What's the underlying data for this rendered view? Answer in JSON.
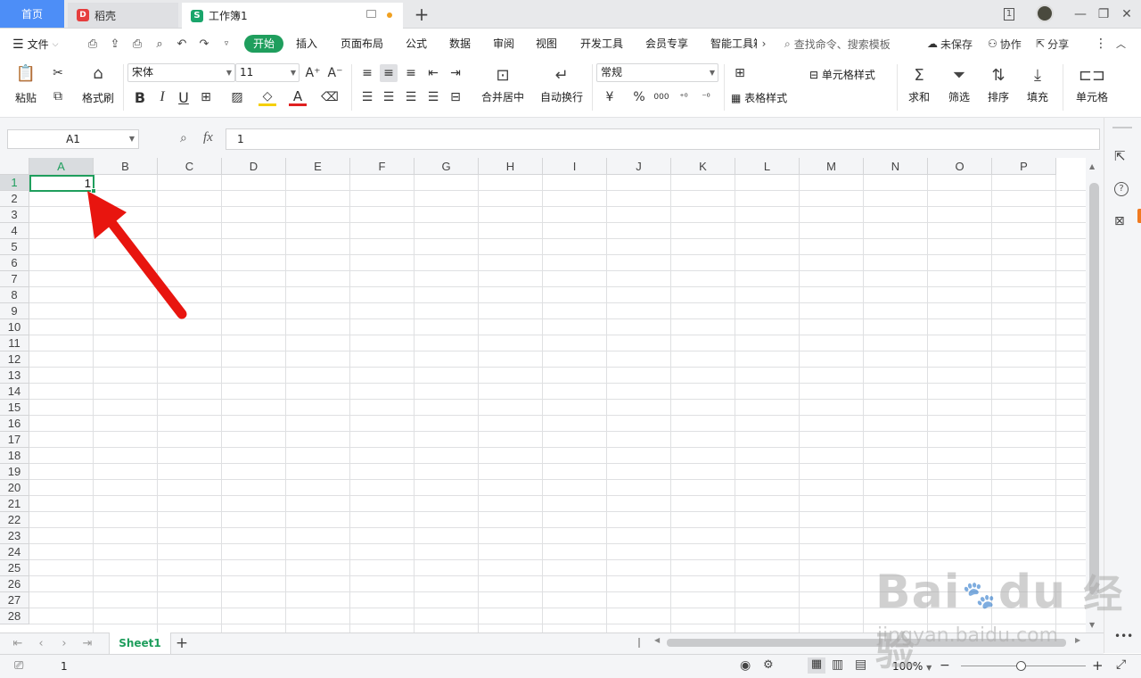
{
  "tabs": {
    "home": "首页",
    "docer": "稻壳",
    "workbook": "工作簿1",
    "add": "+"
  },
  "window": {
    "page_count": "1"
  },
  "menu": {
    "file": "文件",
    "start": "开始",
    "items": [
      "插入",
      "页面布局",
      "公式",
      "数据",
      "审阅",
      "视图",
      "开发工具",
      "会员专享",
      "智能工具箱"
    ],
    "search": "查找命令、搜索模板",
    "unsaved": "未保存",
    "collab": "协作",
    "share": "分享"
  },
  "ribbon": {
    "paste": "粘贴",
    "format_painter": "格式刷",
    "font_name": "宋体",
    "font_size": "11",
    "merge_center": "合并居中",
    "wrap_text": "自动换行",
    "number_format": "常规",
    "currency_symbol": "¥",
    "percent": "%",
    "thousands": "000",
    "cell_style": "单元格样式",
    "table_style": "表格样式",
    "sum": "求和",
    "filter": "筛选",
    "sort": "排序",
    "fill": "填充",
    "cells": "单元格",
    "bold": "B",
    "italic": "I",
    "underline": "U",
    "font_color": "A"
  },
  "formula_bar": {
    "name_box": "A1",
    "fx": "fx",
    "value": "1"
  },
  "columns": [
    "A",
    "B",
    "C",
    "D",
    "E",
    "F",
    "G",
    "H",
    "I",
    "J",
    "K",
    "L",
    "M",
    "N",
    "O",
    "P"
  ],
  "rows": [
    "1",
    "2",
    "3",
    "4",
    "5",
    "6",
    "7",
    "8",
    "9",
    "10",
    "11",
    "12",
    "13",
    "14",
    "15",
    "16",
    "17",
    "18",
    "19",
    "20",
    "21",
    "22",
    "23",
    "24",
    "25",
    "26",
    "27",
    "28"
  ],
  "cells": {
    "A1": "1"
  },
  "sheets": {
    "active": "Sheet1"
  },
  "status": {
    "value": "1",
    "zoom": "100%"
  },
  "watermark": {
    "brand": "Bai",
    "brand2": "du",
    "product": "经验",
    "url": "jingyan.baidu.com"
  },
  "colors": {
    "accent": "#1f9e5d",
    "home_tab": "#4d8ef7",
    "arrow": "#e8150f"
  }
}
